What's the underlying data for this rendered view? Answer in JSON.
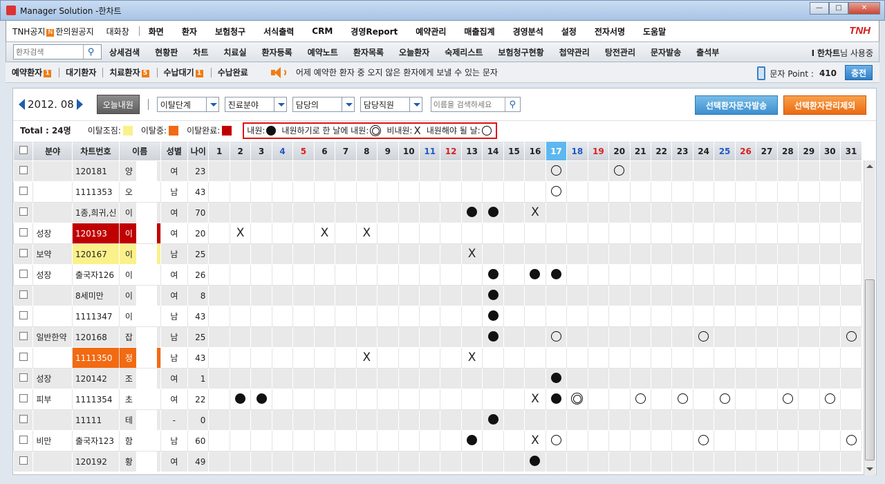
{
  "window": {
    "title": "Manager Solution -한차트",
    "min": "—",
    "max": "□",
    "close": "✕"
  },
  "menu1": {
    "items": [
      "TNH공지",
      "한의원공지",
      "대화창"
    ],
    "badge": "N",
    "main": [
      "화면",
      "환자",
      "보험청구",
      "서식출력",
      "CRM",
      "경영Report",
      "예약관리",
      "매출집계",
      "경영분석",
      "설정",
      "전자서명",
      "도움말"
    ],
    "brand": "TNH"
  },
  "menu2": {
    "search_placeholder": "환자검색",
    "items": [
      "상세검색",
      "현황판",
      "차트",
      "치료실",
      "환자등록",
      "예약노트",
      "환자목록",
      "오늘환자",
      "숙제리스트",
      "보험청구현황",
      "첩약관리",
      "탕전관리",
      "문자발송",
      "출석부"
    ],
    "user_prefix": "I",
    "user_name": "한차트",
    "user_suffix": "님 사용중"
  },
  "menu3": {
    "tabs": [
      {
        "label": "예약환자",
        "badge": "1"
      },
      {
        "label": "대기환자",
        "badge": ""
      },
      {
        "label": "치료환자",
        "badge": "5"
      },
      {
        "label": "수납대기",
        "badge": "1"
      },
      {
        "label": "수납완료",
        "badge": ""
      }
    ],
    "notice": "어제 예약한 환자 중 오지 않은 환자에게 보낼 수 있는 문자",
    "point_label": "문자 Point :",
    "point_value": "410",
    "charge_label": "충전"
  },
  "toolbar": {
    "month": "2012. 08",
    "today_btn": "오늘내원",
    "dropdowns": [
      "이탈단계",
      "진료분야",
      "담당의",
      "담당직원"
    ],
    "name_search_placeholder": "이름을 검색하세요",
    "send_btn": "선택환자문자발송",
    "exclude_btn": "선택환자관리제외"
  },
  "legend": {
    "total": "Total : 24명",
    "status": [
      {
        "label": "이탈조짐:",
        "color": "#fbf18a"
      },
      {
        "label": "이탈중:",
        "color": "#f26a12"
      },
      {
        "label": "이탈완료:",
        "color": "#c00000"
      }
    ],
    "marks": [
      {
        "label": "내원:",
        "type": "f"
      },
      {
        "label": "내원하기로 한 날에 내원:",
        "type": "d"
      },
      {
        "label": "비내원:",
        "type": "x"
      },
      {
        "label": "내원해야 될 날:",
        "type": "o"
      }
    ]
  },
  "table": {
    "headers": [
      "분야",
      "차트번호",
      "이름",
      "성별",
      "나이"
    ],
    "days": [
      "1",
      "2",
      "3",
      "4",
      "5",
      "6",
      "7",
      "8",
      "9",
      "10",
      "11",
      "12",
      "13",
      "14",
      "15",
      "16",
      "17",
      "18",
      "19",
      "20",
      "21",
      "22",
      "23",
      "24",
      "25",
      "26",
      "27",
      "28",
      "29",
      "30",
      "31"
    ],
    "blue_days": [
      "4",
      "11",
      "18",
      "25"
    ],
    "red_days": [
      "5",
      "12",
      "19",
      "26"
    ],
    "today": "17",
    "rows": [
      {
        "field": "",
        "chart": "120181",
        "name": "양",
        "sex": "여",
        "age": "23",
        "status": "",
        "marks": {
          "17": "o",
          "20": "o"
        }
      },
      {
        "field": "",
        "chart": "1111353",
        "name": "오",
        "sex": "남",
        "age": "43",
        "status": "",
        "marks": {
          "17": "o"
        }
      },
      {
        "field": "",
        "chart": "1종,희귀,신",
        "name": "이",
        "sex": "여",
        "age": "70",
        "status": "",
        "marks": {
          "13": "f",
          "14": "f",
          "16": "x"
        }
      },
      {
        "field": "성장",
        "chart": "120193",
        "name": "이",
        "sex": "여",
        "age": "20",
        "status": "red",
        "marks": {
          "2": "x",
          "6": "x",
          "8": "x"
        }
      },
      {
        "field": "보약",
        "chart": "120167",
        "name": "이",
        "sex": "남",
        "age": "25",
        "status": "yel",
        "marks": {
          "13": "x"
        }
      },
      {
        "field": "성장",
        "chart": "출국자126",
        "name": "이",
        "sex": "여",
        "age": "26",
        "status": "",
        "marks": {
          "14": "f",
          "16": "f",
          "17": "f"
        }
      },
      {
        "field": "",
        "chart": "8세미만",
        "name": "이",
        "sex": "여",
        "age": "8",
        "status": "",
        "marks": {
          "14": "f"
        }
      },
      {
        "field": "",
        "chart": "1111347",
        "name": "이",
        "sex": "남",
        "age": "43",
        "status": "",
        "marks": {
          "14": "f"
        }
      },
      {
        "field": "일반한약",
        "chart": "120168",
        "name": "잡",
        "sex": "남",
        "age": "25",
        "status": "",
        "marks": {
          "14": "f",
          "17": "o",
          "24": "o",
          "31": "o"
        }
      },
      {
        "field": "",
        "chart": "1111350",
        "name": "정",
        "sex": "남",
        "age": "43",
        "status": "ora",
        "marks": {
          "8": "x",
          "13": "x"
        }
      },
      {
        "field": "성장",
        "chart": "120142",
        "name": "조",
        "sex": "여",
        "age": "1",
        "status": "",
        "marks": {
          "17": "f"
        }
      },
      {
        "field": "피부",
        "chart": "1111354",
        "name": "초",
        "sex": "여",
        "age": "22",
        "status": "",
        "marks": {
          "2": "f",
          "3": "f",
          "16": "x",
          "17": "f",
          "18": "d",
          "21": "o",
          "23": "o",
          "25": "o",
          "28": "o",
          "30": "o"
        }
      },
      {
        "field": "",
        "chart": "11111",
        "name": "테",
        "sex": "-",
        "age": "0",
        "status": "",
        "marks": {
          "14": "f"
        }
      },
      {
        "field": "비만",
        "chart": "출국자123",
        "name": "함",
        "sex": "남",
        "age": "60",
        "status": "",
        "marks": {
          "13": "f",
          "16": "x",
          "17": "o",
          "24": "o",
          "31": "o"
        }
      },
      {
        "field": "",
        "chart": "120192",
        "name": "황",
        "sex": "여",
        "age": "49",
        "status": "",
        "marks": {
          "16": "f"
        }
      }
    ]
  }
}
